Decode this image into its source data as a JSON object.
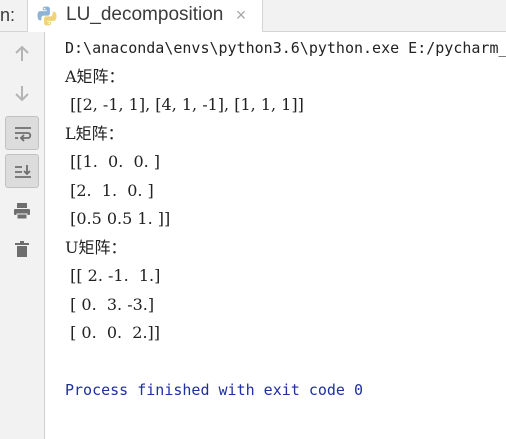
{
  "tabbar": {
    "prefix": "n:",
    "tab": {
      "label": "LU_decomposition",
      "close_glyph": "×",
      "icon": "python-icon"
    }
  },
  "toolstrip": {
    "buttons": [
      {
        "name": "rerun-up-icon",
        "active": false
      },
      {
        "name": "rerun-down-icon",
        "active": false
      },
      {
        "name": "soft-wrap-icon",
        "active": true
      },
      {
        "name": "scroll-to-end-icon",
        "active": true
      },
      {
        "name": "print-icon",
        "active": false
      },
      {
        "name": "clear-all-icon",
        "active": false
      }
    ]
  },
  "console": {
    "command": "D:\\anaconda\\envs\\python3.6\\python.exe E:/pycharm_",
    "a_label": "A矩阵：",
    "a_value": " [[2, -1, 1], [4, 1, -1], [1, 1, 1]]",
    "l_label": "L矩阵：",
    "l_rows": [
      " [[1.  0.  0. ]",
      " [2.  1.  0. ]",
      " [0.5 0.5 1. ]]"
    ],
    "u_label": "U矩阵：",
    "u_rows": [
      " [[ 2. -1.  1.]",
      " [ 0.  3. -3.]",
      " [ 0.  0.  2.]]"
    ],
    "exit_message": "Process finished with exit code 0"
  },
  "colors": {
    "exit_text": "#1f2ea1",
    "text": "#222222",
    "panel": "#f2f2f2"
  }
}
